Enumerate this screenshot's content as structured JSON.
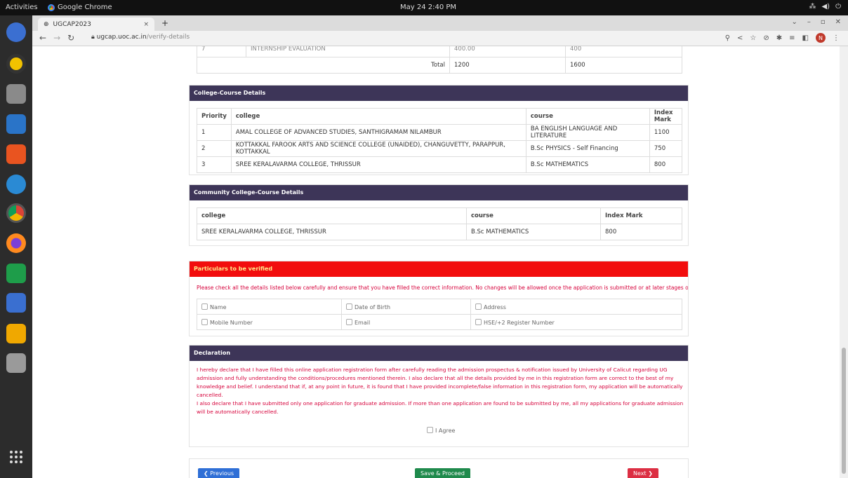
{
  "topbar": {
    "activities": "Activities",
    "app": "Google Chrome",
    "clock": "May 24  2:40 PM",
    "tray": [
      "⁂",
      "◀)",
      "⏻"
    ]
  },
  "browser": {
    "tab_title": "UGCAP2023",
    "tab_close": "×",
    "new_tab": "+",
    "url_host": "ugcap.uoc.ac.in",
    "url_path": "/verify-details",
    "avatar_letter": "N"
  },
  "marks_table": {
    "partial_row": {
      "no": "7",
      "item": "INTERNSHIP EVALUATION",
      "score": "400.00",
      "max": "400"
    },
    "total_label": "Total",
    "total_score": "1200",
    "total_max": "1600"
  },
  "college_course": {
    "heading": "College-Course Details",
    "headers": [
      "Priority",
      "college",
      "course",
      "Index Mark"
    ],
    "rows": [
      [
        "1",
        "AMAL COLLEGE OF ADVANCED STUDIES, SANTHIGRAMAM NILAMBUR",
        "BA ENGLISH LANGUAGE AND LITERATURE",
        "1100"
      ],
      [
        "2",
        "KOTTAKKAL FAROOK ARTS AND SCIENCE COLLEGE (UNAIDED), CHANGUVETTY, PARAPPUR, KOTTAKKAL",
        "B.Sc PHYSICS - Self Financing",
        "750"
      ],
      [
        "3",
        "SREE KERALAVARMA COLLEGE, THRISSUR",
        "B.Sc MATHEMATICS",
        "800"
      ]
    ]
  },
  "community_course": {
    "heading": "Community College-Course Details",
    "headers": [
      "college",
      "course",
      "Index Mark"
    ],
    "rows": [
      [
        "SREE KERALAVARMA COLLEGE, THRISSUR",
        "B.Sc MATHEMATICS",
        "800"
      ]
    ]
  },
  "verify": {
    "heading": "Particulars to be verified",
    "instruction": "Please check all the details listed below carefully and ensure that you have filled the correct information. No changes will be allowed once the application is submitted or at later stages of admission.",
    "items": [
      "Name",
      "Date of Birth",
      "Address",
      "Mobile Number",
      "Email",
      "HSE/+2 Register Number"
    ]
  },
  "declaration": {
    "heading": "Declaration",
    "para1": "I hereby declare that I have filled this online application registration form after carefully reading the admission prospectus & notification issued by University of Calicut regarding UG admission and fully understanding the conditions/procedures mentioned therein. I also declare that all the details provided by me in this registration form are correct to the best of my knowledge and belief. I understand that if, at any point in future, it is found that I have provided incomplete/false information in this registration form, my application will be automatically cancelled.",
    "para2": "I also declare that I have submitted only one application for graduate admission. If more than one application are found to be submitted by me, all my applications for graduate admission will be automatically cancelled.",
    "agree": "I Agree"
  },
  "buttons": {
    "previous": "Previous",
    "save": "Save & Proceed",
    "next": "Next"
  },
  "colors": {
    "panel_header": "#3d3558",
    "alert_header": "#f20d0d",
    "previous": "#2f6fd6",
    "save": "#1f8a4c",
    "next": "#dc2f43"
  }
}
